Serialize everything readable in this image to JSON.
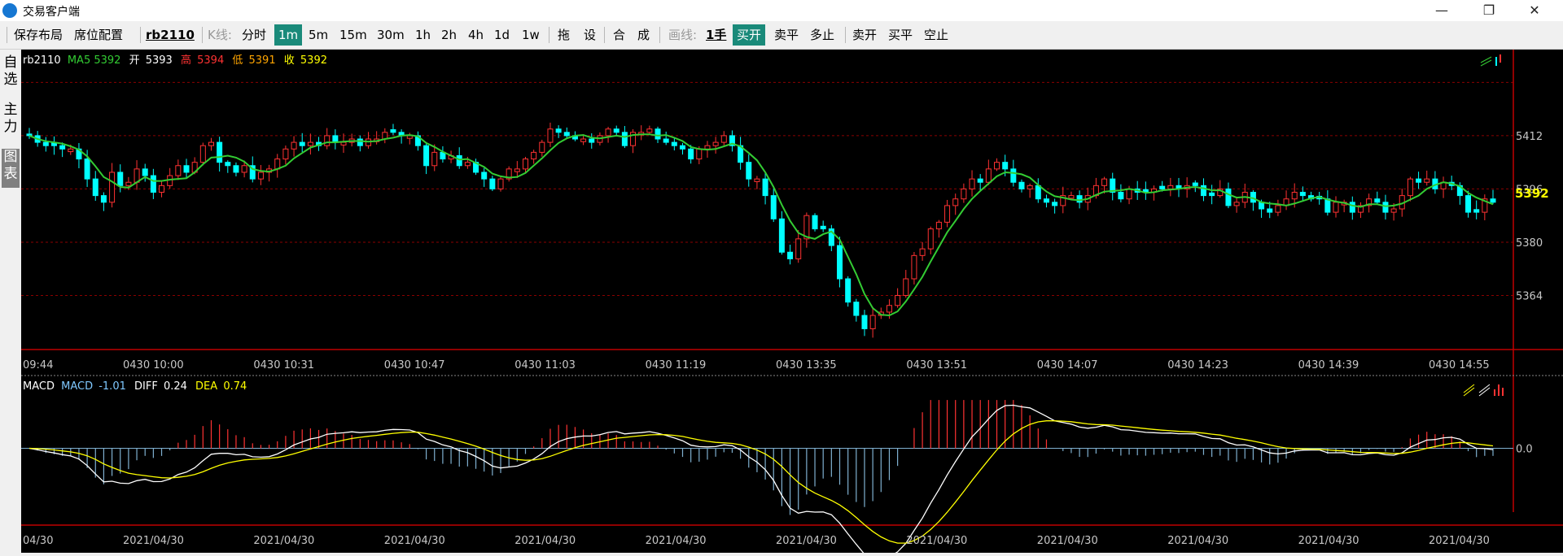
{
  "window": {
    "title": "交易客户端",
    "minimize": "—",
    "maximize": "❐",
    "close": "✕",
    "icon": "app-logo-icon"
  },
  "toolbar": {
    "save_layout": "保存布局",
    "seat_config": "席位配置",
    "symbol": "rb2110",
    "kline_label": "K线:",
    "periods": [
      "分时",
      "1m",
      "5m",
      "15m",
      "30m",
      "1h",
      "2h",
      "4h",
      "1d",
      "1w"
    ],
    "active_period": "1m",
    "tools": [
      "拖",
      "设",
      "合",
      "成"
    ],
    "draw_label": "画线:",
    "lot": "1手",
    "buy_open": "买开",
    "sell_close": "卖平",
    "stop_long": "多止",
    "sell_open": "卖开",
    "buy_close": "买平",
    "stop_short": "空止"
  },
  "sidebar": {
    "tabs": [
      "自选",
      "主力",
      "图表"
    ],
    "active": "图表"
  },
  "colors": {
    "up": "#ff3232",
    "down": "#00ffff",
    "ma": "#33cc33",
    "macd_line": "#ffffff",
    "dea_line": "#ffff00",
    "grid": "#8b0000",
    "accent": "#1a8a7a"
  },
  "chart_data": [
    {
      "type": "candlestick",
      "symbol": "rb2110",
      "legend": {
        "symbol": "rb2110",
        "ma_label": "MA5 5392",
        "open_label": "开",
        "open": "5393",
        "high_label": "高",
        "high": "5394",
        "low_label": "低",
        "low": "5391",
        "close_label": "收",
        "close": "5392"
      },
      "ylim": [
        5348,
        5432
      ],
      "y_ticks": [
        5412,
        5396,
        5380,
        5364
      ],
      "last_price": "5392",
      "x_ticks": [
        "09:44",
        "0430 10:00",
        "0430 10:31",
        "0430 10:47",
        "0430 11:03",
        "0430 11:19",
        "0430 13:35",
        "0430 13:51",
        "0430 14:07",
        "0430 14:23",
        "0430 14:39",
        "0430 14:55"
      ],
      "close_series": [
        5412,
        5410,
        5409,
        5409,
        5408,
        5408,
        5405,
        5399,
        5394,
        5392,
        5401,
        5397,
        5398,
        5402,
        5400,
        5395,
        5397,
        5400,
        5403,
        5401,
        5404,
        5409,
        5410,
        5404,
        5403,
        5401,
        5403,
        5399,
        5401,
        5402,
        5405,
        5408,
        5410,
        5409,
        5410,
        5409,
        5412,
        5410,
        5410,
        5411,
        5409,
        5411,
        5411,
        5413,
        5413,
        5412,
        5412,
        5409,
        5403,
        5407,
        5405,
        5406,
        5403,
        5404,
        5401,
        5399,
        5396,
        5399,
        5402,
        5402,
        5405,
        5407,
        5410,
        5414,
        5413,
        5412,
        5411,
        5411,
        5410,
        5412,
        5414,
        5413,
        5409,
        5413,
        5413,
        5414,
        5411,
        5410,
        5409,
        5408,
        5405,
        5408,
        5409,
        5410,
        5412,
        5409,
        5404,
        5399,
        5399,
        5394,
        5387,
        5377,
        5375,
        5381,
        5388,
        5384,
        5384,
        5379,
        5369,
        5362,
        5358,
        5354,
        5358,
        5359,
        5361,
        5364,
        5369,
        5376,
        5378,
        5384,
        5386,
        5391,
        5393,
        5396,
        5399,
        5398,
        5402,
        5404,
        5402,
        5398,
        5396,
        5397,
        5393,
        5392,
        5391,
        5394,
        5394,
        5392,
        5394,
        5397,
        5399,
        5395,
        5393,
        5396,
        5395,
        5395,
        5396,
        5396,
        5397,
        5396,
        5397,
        5397,
        5394,
        5394,
        5396,
        5391,
        5392,
        5395,
        5392,
        5390,
        5389,
        5391,
        5393,
        5395,
        5394,
        5393,
        5393,
        5389,
        5392,
        5392,
        5389,
        5391,
        5393,
        5392,
        5389,
        5390,
        5394,
        5399,
        5398,
        5399,
        5396,
        5398,
        5397,
        5394,
        5389,
        5389,
        5393,
        5392
      ]
    },
    {
      "type": "macd",
      "legend": {
        "name": "MACD",
        "macd_label": "MACD",
        "macd": "-1.01",
        "diff_label": "DIFF",
        "diff": "0.24",
        "dea_label": "DEA",
        "dea": "0.74"
      },
      "ylim": [
        -8.5,
        5.5
      ],
      "zero_label": "0.0",
      "x_tick_label": "2021/04/30",
      "first_tick_label": "04/30"
    }
  ]
}
